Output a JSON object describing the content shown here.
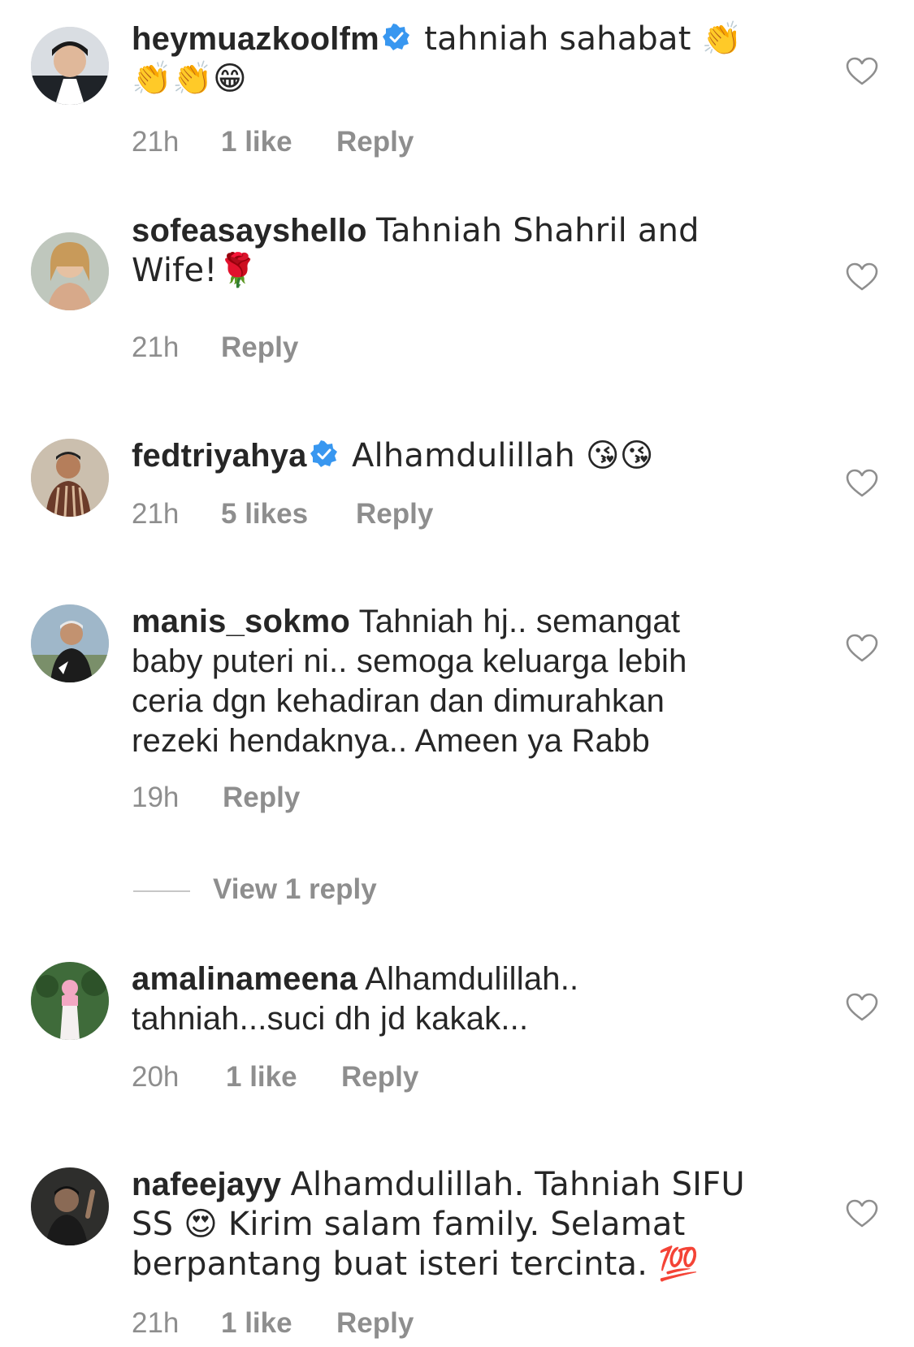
{
  "comments": [
    {
      "username": "heymuazkoolfm",
      "verified": true,
      "text": "tahniah sahabat 👏👏👏😁",
      "time": "21h",
      "likes": "1 like",
      "reply": "Reply"
    },
    {
      "username": "sofeasayshello",
      "verified": false,
      "text": "Tahniah Shahril and Wife!🌹",
      "time": "21h",
      "likes": "",
      "reply": "Reply"
    },
    {
      "username": "fedtriyahya",
      "verified": true,
      "text": "Alhamdulillah 😘😘",
      "time": "21h",
      "likes": "5 likes",
      "reply": "Reply"
    },
    {
      "username": "manis_sokmo",
      "verified": false,
      "text": "Tahniah hj.. semangat baby puteri ni.. semoga keluarga lebih ceria dgn kehadiran dan dimurahkan rezeki hendaknya.. Ameen ya Rabb",
      "time": "19h",
      "likes": "",
      "reply": "Reply"
    },
    {
      "username": "amalinameena",
      "verified": false,
      "text": "Alhamdulillah.. tahniah...suci dh jd kakak...",
      "time": "20h",
      "likes": "1 like",
      "reply": "Reply"
    },
    {
      "username": "nafeejayy",
      "verified": false,
      "text": "Alhamdulillah. Tahniah SIFU SS 😍 Kirim salam family. Selamat berpantang buat isteri tercinta. 💯",
      "time": "21h",
      "likes": "1 like",
      "reply": "Reply"
    }
  ],
  "view_replies": {
    "label": "View 1 reply"
  },
  "icons": {
    "like": "heart-outline-icon",
    "verified": "verified-badge-icon"
  },
  "colors": {
    "text": "#262626",
    "secondary": "#8e8e8e",
    "verified": "#3897f0"
  }
}
